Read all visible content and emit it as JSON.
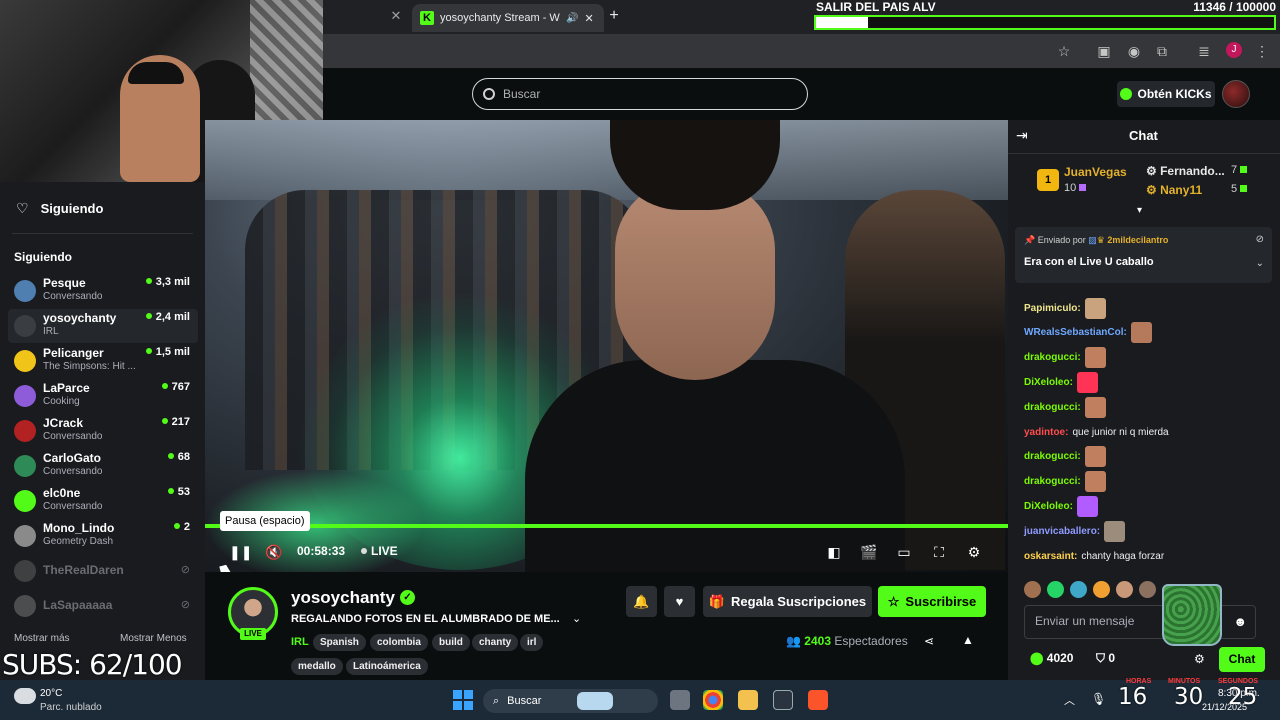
{
  "browser": {
    "prev_tab_close": "✕",
    "active_tab_title": "yosoychanty Stream - Watc",
    "new_tab": "+"
  },
  "goal_overlay": {
    "title": "SALIR DEL PAIS ALV",
    "count": "11346 / 100000",
    "progress": 0.113
  },
  "header": {
    "search_placeholder": "Buscar",
    "kicks_button": "Obtén KICKs"
  },
  "sidebar": {
    "header_label": "Siguiendo",
    "section_heading": "Siguiendo",
    "channels": [
      {
        "name": "Pesque",
        "category": "Conversando",
        "viewers": "3,3 mil",
        "color": "#4f7fb0"
      },
      {
        "name": "yosoychanty",
        "category": "IRL",
        "viewers": "2,4 mil",
        "color": "#3a3d42"
      },
      {
        "name": "Pelicanger",
        "category": "The Simpsons: Hit ...",
        "viewers": "1,5 mil",
        "color": "#f0c419"
      },
      {
        "name": "LaParce",
        "category": "Cooking",
        "viewers": "767",
        "color": "#8e5cd9"
      },
      {
        "name": "JCrack",
        "category": "Conversando",
        "viewers": "217",
        "color": "#b22222"
      },
      {
        "name": "CarloGato",
        "category": "Conversando",
        "viewers": "68",
        "color": "#2e8b57"
      },
      {
        "name": "elc0ne",
        "category": "Conversando",
        "viewers": "53",
        "color": "#53fc18"
      },
      {
        "name": "Mono_Lindo",
        "category": "Geometry Dash",
        "viewers": "2",
        "color": "#8a8a8a"
      }
    ],
    "offline": [
      {
        "name": "TheRealDaren",
        "color": "#777"
      },
      {
        "name": "LaSapaaaaa",
        "color": "#999"
      }
    ],
    "show_more": "Mostrar más",
    "show_less": "Mostrar Menos"
  },
  "subs_overlay": "SUBS: 62/100",
  "player": {
    "tooltip": "Pausa (espacio)",
    "time": "00:58:33",
    "live_label": "LIVE",
    "progress": 1.0
  },
  "channel": {
    "name": "yosoychanty",
    "live_badge": "LIVE",
    "title": "REGALANDO FOTOS EN EL ALUMBRADO DE ME...",
    "category": "IRL",
    "tags": [
      "Spanish",
      "colombia",
      "build",
      "chanty",
      "irl",
      "medallo",
      "Latinoámerica"
    ],
    "gift_subs_label": "Regala Suscripciones",
    "subscribe_label": "Suscribirse",
    "viewers": "2403",
    "viewers_label": "Espectadores"
  },
  "chat": {
    "title": "Chat",
    "leaderboard": [
      {
        "rank": "1",
        "name": "JuanVegas",
        "value": "10"
      },
      {
        "name": "Fernando...",
        "value": "7"
      },
      {
        "name": "Nany11",
        "value": "5"
      }
    ],
    "pinned": {
      "sent_by": "Enviado por",
      "author": "2mildecilantro",
      "text": "Era con el Live U caballo"
    },
    "messages": [
      {
        "user": "Papimiculo:",
        "color": "#f0e68c",
        "emote": "#c9a27e",
        "text": ""
      },
      {
        "user": "WRealsSebastianCol:",
        "color": "#6fa8ff",
        "emote": "#b57a5c",
        "text": ""
      },
      {
        "user": "drakogucci:",
        "color": "#7cfc00",
        "emote": "#c08060",
        "text": ""
      },
      {
        "user": "DiXeloleo:",
        "color": "#7cfc00",
        "emote": "#ff3355",
        "text": ""
      },
      {
        "user": "drakogucci:",
        "color": "#7cfc00",
        "emote": "#c08060",
        "text": ""
      },
      {
        "user": "yadintoe:",
        "color": "#ff4d4d",
        "emote": "",
        "text": "que junior ni q mierda"
      },
      {
        "user": "drakogucci:",
        "color": "#7cfc00",
        "emote": "#c08060",
        "text": ""
      },
      {
        "user": "drakogucci:",
        "color": "#7cfc00",
        "emote": "#c08060",
        "text": ""
      },
      {
        "user": "DiXeloleo:",
        "color": "#7cfc00",
        "emote": "#b05cff",
        "text": ""
      },
      {
        "user": "juanvicaballero:",
        "color": "#8f9bff",
        "emote": "#9c8c7c",
        "text": ""
      },
      {
        "user": "oskarsaint:",
        "color": "#ffd24d",
        "emote": "",
        "text": "chanty haga forzar"
      }
    ],
    "input_placeholder": "Enviar un mensaje",
    "kicks_balance": "4020",
    "points": "0",
    "send_label": "Chat"
  },
  "taskbar": {
    "temp": "20°C",
    "weather": "Parc. nublado",
    "search_label": "Buscar",
    "clock_time": "8:30 p.m.",
    "clock_date": "21/12/2025"
  },
  "timer_overlay": {
    "hours": "16",
    "minutes": "30",
    "seconds": "25",
    "hours_label": "HORAS",
    "minutes_label": "MINUTOS",
    "seconds_label": "SEGUNDOS"
  }
}
